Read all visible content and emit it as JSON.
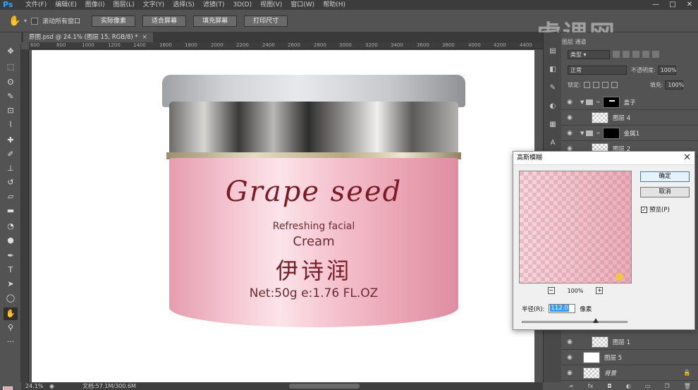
{
  "menubar": {
    "logo": "Ps",
    "items": [
      "文件(F)",
      "编辑(E)",
      "图像(I)",
      "图层(L)",
      "文字(Y)",
      "选择(S)",
      "滤镜(T)",
      "3D(D)",
      "视图(V)",
      "窗口(W)",
      "帮助(H)"
    ],
    "win_controls": [
      "—",
      "□",
      "✕"
    ]
  },
  "options": {
    "scroll_all_label": "滚动所有窗口",
    "buttons": [
      "实际像素",
      "适合屏幕",
      "填充屏幕",
      "打印尺寸"
    ]
  },
  "document": {
    "tab_title": "原图.psd @ 24.1% (图层 15, RGB/8) *",
    "tab_close": "×"
  },
  "ruler": {
    "h_ticks": [
      "600",
      "800",
      "1000",
      "1200",
      "1400",
      "1600",
      "1800",
      "2000",
      "2200",
      "2400",
      "2600",
      "2800",
      "3000",
      "3200",
      "3400",
      "3600",
      "3800",
      "4000",
      "4200",
      "4400"
    ]
  },
  "canvas": {
    "brand": "Grape seed",
    "subtitle": "Refreshing facial",
    "product": "Cream",
    "chinese_name": "伊诗润",
    "net": "Net:50g e:1.76 FL.OZ"
  },
  "status": {
    "zoom": "24.1%",
    "doc": "文档:57.1M/300.6M"
  },
  "watermark": "虎课网",
  "layers_panel": {
    "tabs": "图层  通道",
    "filter_kind": "类型",
    "blend_mode": "正常",
    "opacity_label": "不透明度:",
    "opacity_value": "100%",
    "lock_label": "锁定:",
    "fill_label": "填充:",
    "fill_value": "100%",
    "layers": [
      {
        "name": "盖子",
        "kind": "group-mask"
      },
      {
        "name": "图层 4",
        "kind": "checker"
      },
      {
        "name": "金属1",
        "kind": "group-black"
      },
      {
        "name": "图层 2",
        "kind": "checker"
      },
      {
        "name": "图层 1",
        "kind": "checker"
      },
      {
        "name": "图层 5",
        "kind": "white"
      },
      {
        "name": "背景",
        "kind": "background"
      }
    ]
  },
  "dialog": {
    "title": "高斯模糊",
    "ok": "确定",
    "cancel": "取消",
    "preview_label": "预览(P)",
    "zoom": "100%",
    "radius_label": "半径(R):",
    "radius_value": "112.0",
    "unit": "像素",
    "slider_fraction": 0.7
  }
}
